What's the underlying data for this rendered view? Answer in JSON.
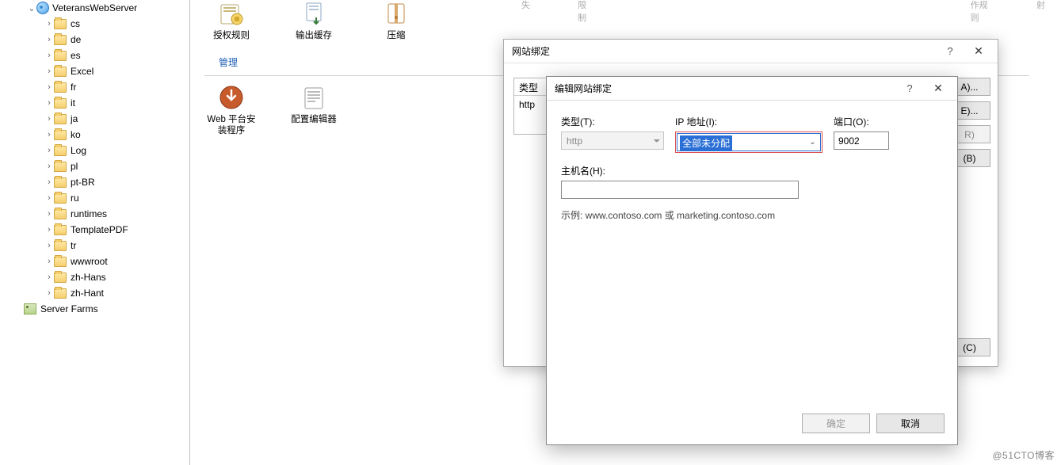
{
  "tree": {
    "root_label": "VeteransWebServer",
    "folders": [
      "cs",
      "de",
      "es",
      "Excel",
      "fr",
      "it",
      "ja",
      "ko",
      "Log",
      "pl",
      "pt-BR",
      "ru",
      "runtimes",
      "TemplatePDF",
      "tr",
      "wwwroot",
      "zh-Hans",
      "zh-Hant"
    ],
    "server_farms": "Server Farms"
  },
  "features": {
    "row1": [
      {
        "label": "授权规则"
      },
      {
        "label": "输出缓存"
      },
      {
        "label": "压缩"
      }
    ],
    "section": "管理",
    "row2": [
      {
        "label": "Web 平台安装程序"
      },
      {
        "label": "配置编辑器"
      }
    ],
    "top_fragment_labels": [
      "失",
      "限制",
      "作规则",
      "射"
    ]
  },
  "outer_dialog": {
    "title": "网站绑定",
    "col_header": "类型",
    "col_value": "http",
    "buttons": {
      "add": "A)...",
      "edit": "E)...",
      "remove": "R)",
      "browse": "(B)",
      "close": "(C)"
    }
  },
  "inner_dialog": {
    "title": "编辑网站绑定",
    "type_label": "类型(T):",
    "type_value": "http",
    "ip_label": "IP 地址(I):",
    "ip_value": "全部未分配",
    "port_label": "端口(O):",
    "port_value": "9002",
    "host_label": "主机名(H):",
    "host_value": "",
    "example": "示例: www.contoso.com 或 marketing.contoso.com",
    "ok": "确定",
    "cancel": "取消"
  },
  "watermark": "@51CTO博客"
}
